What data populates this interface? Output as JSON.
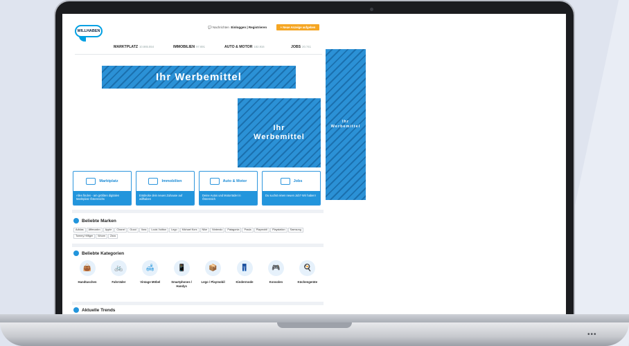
{
  "header": {
    "logo_text": "WILLHABEN",
    "messages_label": "Nachrichten",
    "login_label": "Einloggen | Registrieren",
    "cta_label": "+ Neue Anzeige aufgeben"
  },
  "nav": {
    "items": [
      {
        "label": "MARKTPLATZ",
        "count": "10.865.554"
      },
      {
        "label": "IMMOBILIEN",
        "count": "97.691"
      },
      {
        "label": "AUTO & MOTOR",
        "count": "182.916"
      },
      {
        "label": "JOBS",
        "count": "20.741"
      }
    ]
  },
  "ads": {
    "top_banner": "Ihr Werbemittel",
    "square": "Ihr Werbemittel",
    "skyscraper": "Ihr Werbemittel"
  },
  "cards": [
    {
      "title": "Marktplatz",
      "desc": "Alles finden - am größten digitalen Marktplatz Österreichs"
    },
    {
      "title": "Immobilien",
      "desc": "Entdecke dein neues Zuhause auf willhaben"
    },
    {
      "title": "Auto & Motor",
      "desc": "Deine Autos und Motorräder in Österreich"
    },
    {
      "title": "Jobs",
      "desc": "Du suchst einen neuen Job? Wir haben!"
    }
  ],
  "brands": {
    "title": "Beliebte Marken",
    "items": [
      "Adidas",
      "Affenzahn",
      "Apple",
      "Chanel",
      "Gucci",
      "Ikea",
      "Louis Vuitton",
      "Lego",
      "Michael Kors",
      "Nike",
      "Nintendo",
      "Patagonia",
      "Prada",
      "Playmobil",
      "Playstation",
      "Samsung",
      "Tommy Hilfiger",
      "Woom",
      "Zara"
    ]
  },
  "categories": {
    "title": "Beliebte Kategorien",
    "items": [
      {
        "label": "Handtaschen",
        "icon": "handbag-icon"
      },
      {
        "label": "Fahrräder",
        "icon": "bicycle-icon"
      },
      {
        "label": "Vintage Möbel",
        "icon": "sofa-icon"
      },
      {
        "label": "Smartphones / Handys",
        "icon": "smartphone-icon"
      },
      {
        "label": "Lego / Playmobil",
        "icon": "toy-box-icon"
      },
      {
        "label": "Kindermode",
        "icon": "overalls-icon"
      },
      {
        "label": "Konsolen",
        "icon": "gamepad-icon"
      },
      {
        "label": "Küchengeräte",
        "icon": "kitchen-appliance-icon"
      }
    ]
  },
  "trends": {
    "title": "Aktuelle Trends"
  },
  "colors": {
    "accent": "#2295dc",
    "cta": "#f5a623",
    "ad_stripe": "#1b70ae"
  }
}
